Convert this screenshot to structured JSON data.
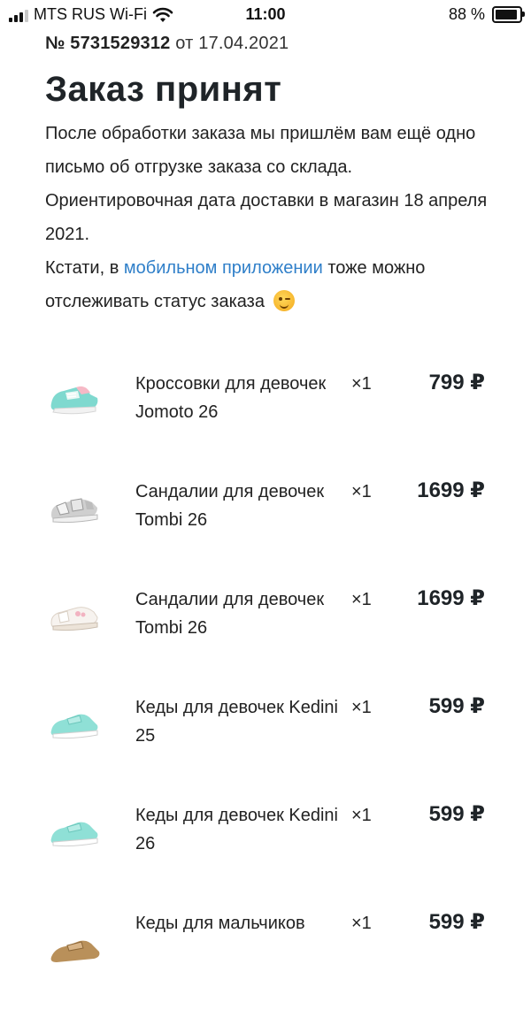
{
  "status_bar": {
    "carrier": "MTS RUS Wi-Fi",
    "time": "11:00",
    "battery": "88 %"
  },
  "order": {
    "number_label": "№ 5731529312",
    "date_text": "от 17.04.2021",
    "title": "Заказ принят",
    "paragraph1": "После обработки заказа мы пришлём вам ещё одно письмо об отгрузке заказа со склада.",
    "paragraph2": "Ориентировочная дата доставки в магазин 18 апреля 2021.",
    "p3_prefix": "Кстати, в ",
    "p3_link": "мобильном приложении",
    "p3_suffix": " тоже можно отслеживать статус заказа"
  },
  "items": [
    {
      "name": "Кроссовки для девочек Jomoto 26",
      "qty": "×1",
      "price": "799 ₽",
      "icon": "sneaker-mint-pink-icon"
    },
    {
      "name": "Сандалии для девочек Tombi 26",
      "qty": "×1",
      "price": "1699 ₽",
      "icon": "sandal-silver-icon"
    },
    {
      "name": "Сандалии для девочек Tombi 26",
      "qty": "×1",
      "price": "1699 ₽",
      "icon": "sandal-white-icon"
    },
    {
      "name": "Кеды для девочек Kedini 25",
      "qty": "×1",
      "price": "599 ₽",
      "icon": "canvas-shoe-mint-icon"
    },
    {
      "name": "Кеды для девочек Kedini 26",
      "qty": "×1",
      "price": "599 ₽",
      "icon": "canvas-shoe-mint-icon"
    },
    {
      "name": "Кеды для мальчиков",
      "qty": "×1",
      "price": "599 ₽",
      "icon": "canvas-shoe-brown-icon"
    }
  ]
}
